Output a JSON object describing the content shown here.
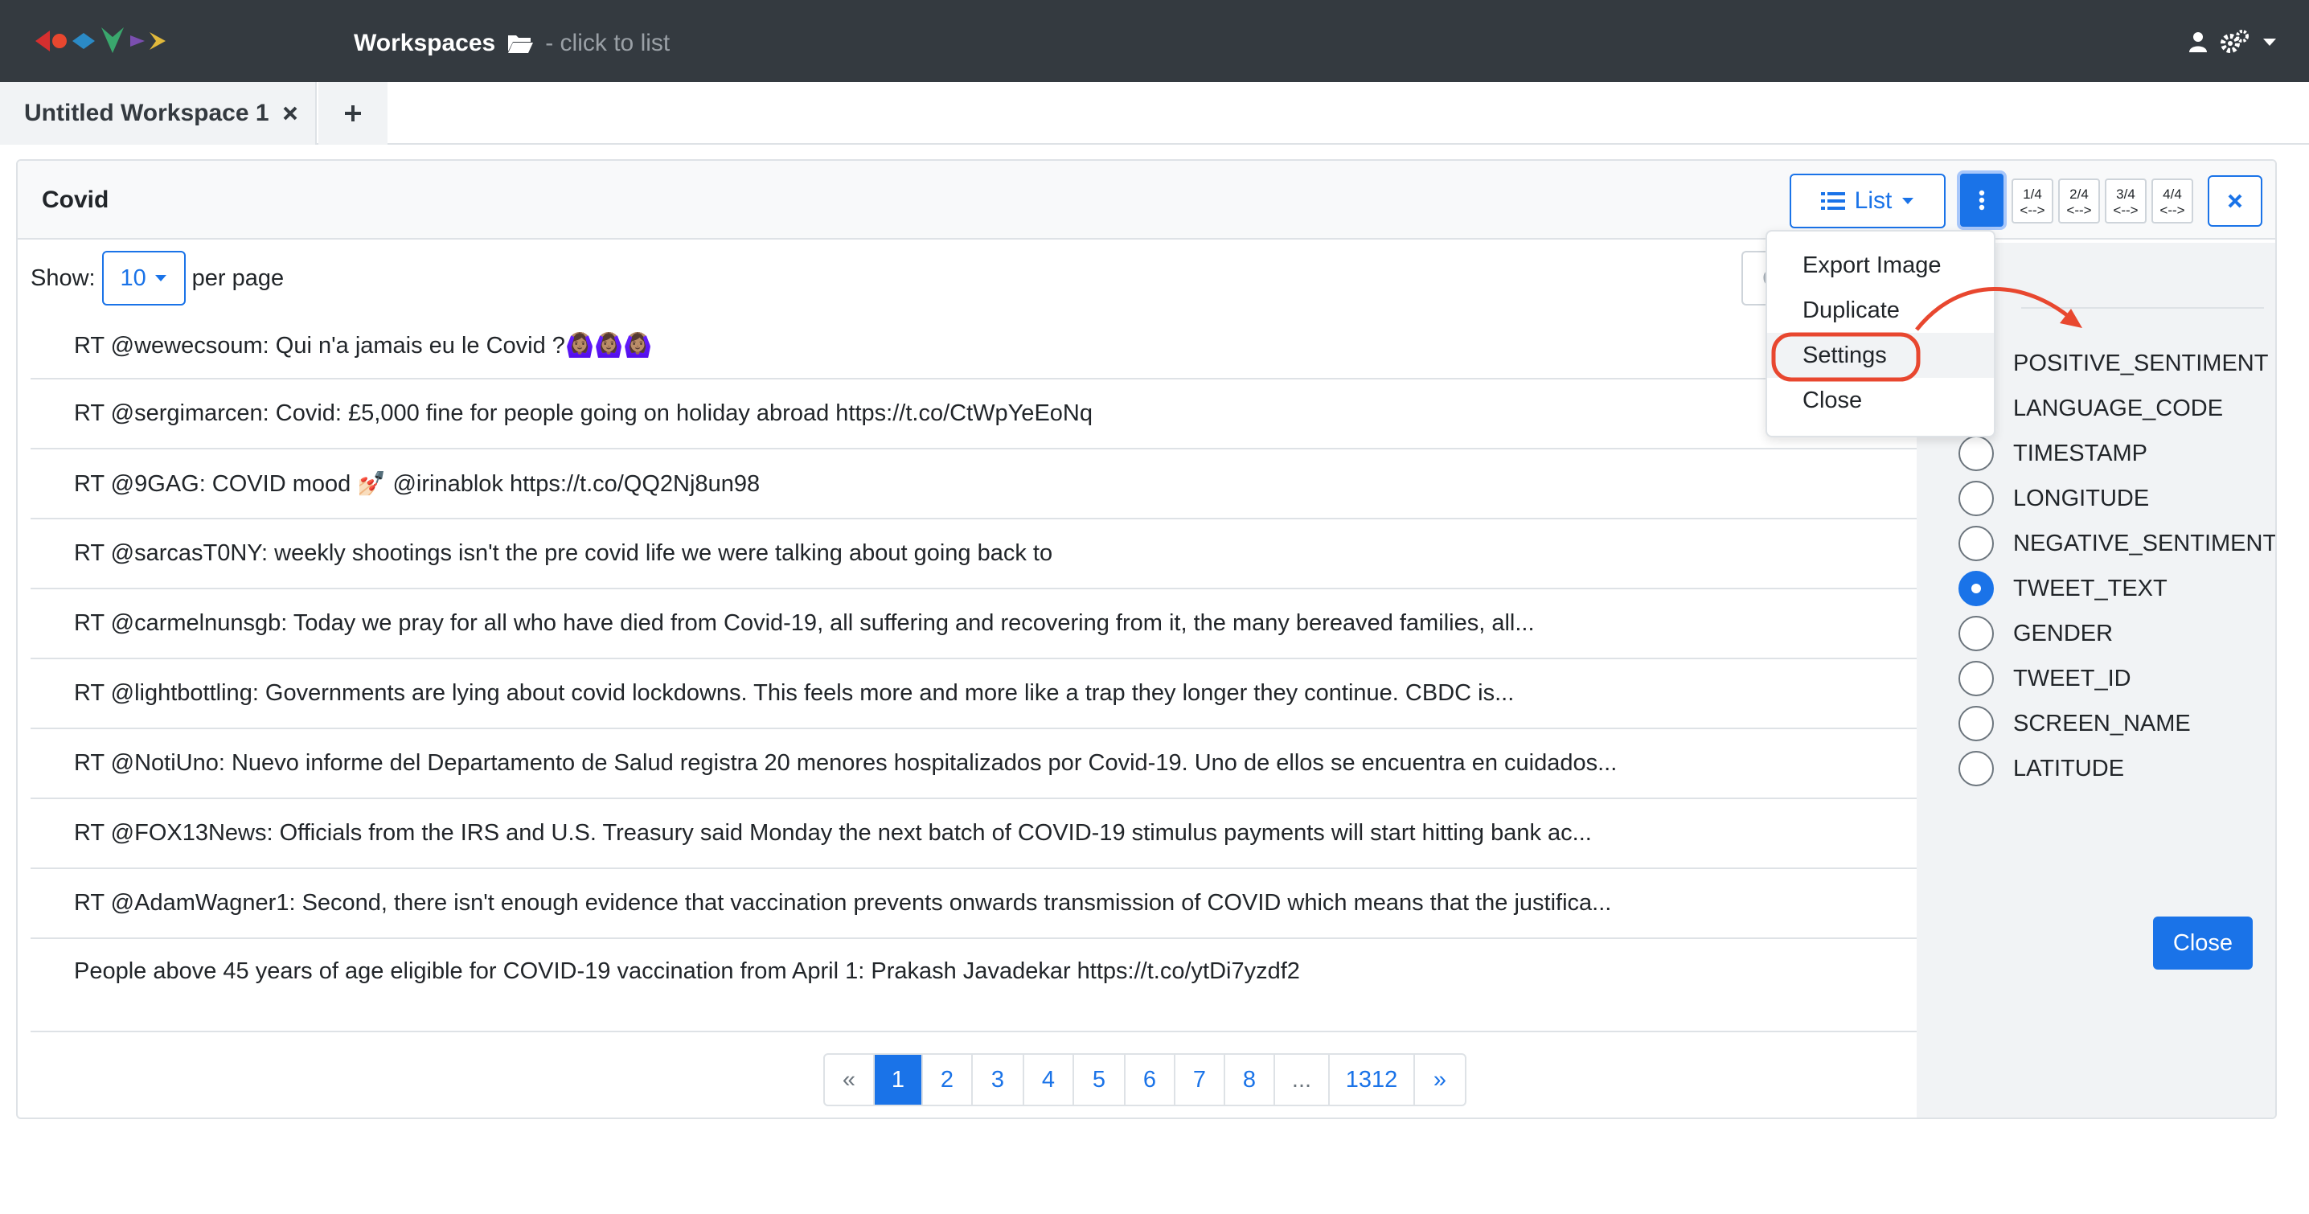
{
  "navbar": {
    "workspaces_label": "Workspaces",
    "workspaces_hint": "- click to list",
    "icons": [
      "logo",
      "folder-open-icon",
      "user-icon",
      "gears-icon",
      "caret-down-icon"
    ]
  },
  "tabs": {
    "items": [
      {
        "label": "Untitled Workspace 1"
      }
    ],
    "add_icon": "plus-icon",
    "close_icon": "times-icon"
  },
  "panel": {
    "title": "Covid",
    "view_button_label": "List",
    "width_buttons": [
      {
        "top": "1/4",
        "bottom": "<-->"
      },
      {
        "top": "2/4",
        "bottom": "<-->"
      },
      {
        "top": "3/4",
        "bottom": "<-->"
      },
      {
        "top": "4/4",
        "bottom": "<-->"
      }
    ],
    "show_label": "Show:",
    "per_page_value": "10",
    "per_page_label": "per page",
    "search_stub": "C"
  },
  "tweets": [
    "RT @wewecsoum: Qui n'a jamais eu le Covid ?🙆🏽‍♀️🙆🏽‍♀️🙆🏽‍♀️",
    "RT @sergimarcen: Covid: £5,000 fine for people going on holiday abroad https://t.co/CtWpYeEoNq",
    "RT @9GAG: COVID mood 💅🏻 @irinablok https://t.co/QQ2Nj8un98",
    "RT @sarcasT0NY: weekly shootings isn't the pre covid life we were talking about going back to",
    "RT @carmelnunsgb: Today we pray for all who have died from Covid-19, all suffering and recovering from it, the many bereaved families, all...",
    "RT @lightbottling: Governments are lying about covid lockdowns. This feels more and more like a trap they longer they continue. CBDC is...",
    "RT @NotiUno: Nuevo informe del Departamento de Salud registra 20 menores hospitalizados por Covid-19. Uno de ellos se encuentra en cuidados...",
    "RT @FOX13News: Officials from the IRS and U.S. Treasury said Monday the next batch of COVID-19 stimulus payments will start hitting bank ac...",
    "RT @AdamWagner1: Second, there isn't enough evidence that vaccination prevents onwards transmission of COVID which means that the justifica...",
    "People above 45 years of age eligible for COVID-19 vaccination from April 1: Prakash Javadekar https://t.co/ytDi7yzdf2"
  ],
  "pagination": {
    "items": [
      "«",
      "1",
      "2",
      "3",
      "4",
      "5",
      "6",
      "7",
      "8",
      "...",
      "1312",
      "»"
    ],
    "active": "1"
  },
  "dropdown": {
    "items": [
      "Export Image",
      "Duplicate",
      "Settings",
      "Close"
    ],
    "highlighted": "Settings"
  },
  "settings": {
    "fields": [
      {
        "label": "POSITIVE_SENTIMENT",
        "checked": false
      },
      {
        "label": "LANGUAGE_CODE",
        "checked": false
      },
      {
        "label": "TIMESTAMP",
        "checked": false
      },
      {
        "label": "LONGITUDE",
        "checked": false
      },
      {
        "label": "NEGATIVE_SENTIMENT",
        "checked": false
      },
      {
        "label": "TWEET_TEXT",
        "checked": true
      },
      {
        "label": "GENDER",
        "checked": false
      },
      {
        "label": "TWEET_ID",
        "checked": false
      },
      {
        "label": "SCREEN_NAME",
        "checked": false
      },
      {
        "label": "LATITUDE",
        "checked": false
      }
    ],
    "close_label": "Close"
  },
  "colors": {
    "navbar": "#343a40",
    "primary": "#1a73e8",
    "annotation": "#e8472f"
  }
}
